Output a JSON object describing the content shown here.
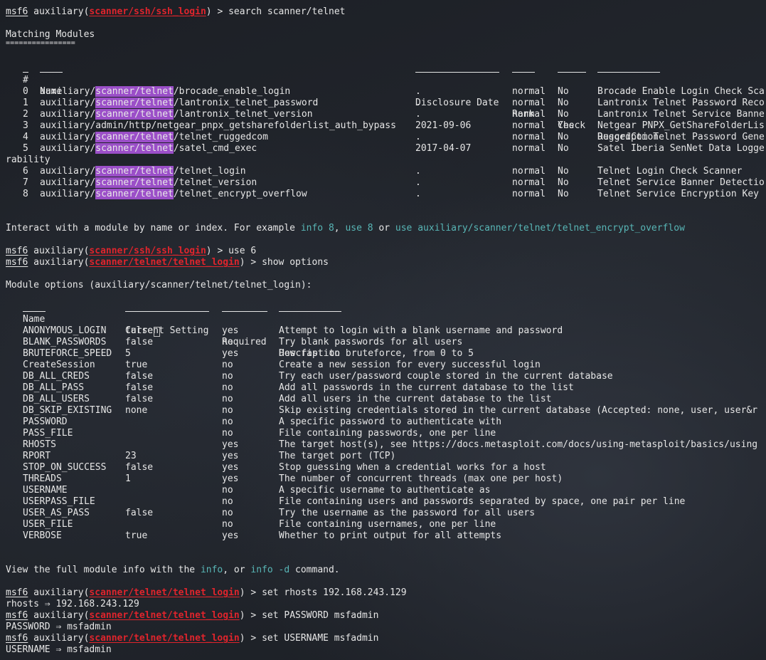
{
  "prompt": {
    "msf": "msf6",
    "aux": "auxiliary(",
    "close": ") > "
  },
  "line1": {
    "module": "scanner/ssh/ssh_login",
    "cmd": "search scanner/telnet"
  },
  "matching": {
    "title": "Matching Modules",
    "underline": "================"
  },
  "search_table": {
    "headers": {
      "num": "#",
      "name": "Name",
      "date": "Disclosure Date",
      "rank": "Rank",
      "check": "Check",
      "desc": "Description"
    },
    "rows": [
      {
        "num": "0",
        "pre": "auxiliary/",
        "hl": "scanner/telnet",
        "post": "/brocade_enable_login",
        "date": ".",
        "rank": "normal",
        "check": "No",
        "desc": "Brocade Enable Login Check Sca"
      },
      {
        "num": "1",
        "pre": "auxiliary/",
        "hl": "scanner/telnet",
        "post": "/lantronix_telnet_password",
        "date": ".",
        "rank": "normal",
        "check": "No",
        "desc": "Lantronix Telnet Password Reco"
      },
      {
        "num": "2",
        "pre": "auxiliary/",
        "hl": "scanner/telnet",
        "post": "/lantronix_telnet_version",
        "date": ".",
        "rank": "normal",
        "check": "No",
        "desc": "Lantronix Telnet Service Banne"
      },
      {
        "num": "3",
        "pre": "auxiliary/admin/http/netgear_pnpx_getsharefolderlist_auth_bypass",
        "hl": "",
        "post": "",
        "date": "2021-09-06",
        "rank": "normal",
        "check": "Yes",
        "desc": "Netgear PNPX_GetShareFolderLis"
      },
      {
        "num": "4",
        "pre": "auxiliary/",
        "hl": "scanner/telnet",
        "post": "/telnet_ruggedcom",
        "date": ".",
        "rank": "normal",
        "check": "No",
        "desc": "RuggedCom Telnet Password Gene"
      },
      {
        "num": "5",
        "pre": "auxiliary/",
        "hl": "scanner/telnet",
        "post": "/satel_cmd_exec",
        "date": "2017-04-07",
        "rank": "normal",
        "check": "No",
        "desc": "Satel Iberia SenNet Data Logge"
      },
      {
        "num": "6",
        "pre": "auxiliary/",
        "hl": "scanner/telnet",
        "post": "/telnet_login",
        "date": ".",
        "rank": "normal",
        "check": "No",
        "desc": "Telnet Login Check Scanner"
      },
      {
        "num": "7",
        "pre": "auxiliary/",
        "hl": "scanner/telnet",
        "post": "/telnet_version",
        "date": ".",
        "rank": "normal",
        "check": "No",
        "desc": "Telnet Service Banner Detectio"
      },
      {
        "num": "8",
        "pre": "auxiliary/",
        "hl": "scanner/telnet",
        "post": "/telnet_encrypt_overflow",
        "date": ".",
        "rank": "normal",
        "check": "No",
        "desc": "Telnet Service Encryption Key"
      }
    ],
    "wrap": "rability"
  },
  "interact": {
    "text": "Interact with a module by name or index. For example ",
    "info": "info 8",
    "comma": ", ",
    "use": "use 8",
    "or": " or ",
    "use_full": "use auxiliary/scanner/telnet/telnet_encrypt_overflow"
  },
  "cmd_use": {
    "module": "scanner/ssh/ssh_login",
    "cmd": "use 6"
  },
  "cmd_show": {
    "module": "scanner/telnet/telnet_login",
    "cmd": "show options"
  },
  "module_options": "Module options (auxiliary/scanner/telnet/telnet_login):",
  "options_table": {
    "headers": {
      "name": "Name",
      "setting": "Current Setting",
      "required": "Required",
      "desc": "Description"
    },
    "rows": [
      {
        "name": "ANONYMOUS_LOGIN",
        "setting": "false",
        "required": "yes",
        "desc": "Attempt to login with a blank username and password"
      },
      {
        "name": "BLANK_PASSWORDS",
        "setting": "false",
        "required": "no",
        "desc": "Try blank passwords for all users"
      },
      {
        "name": "BRUTEFORCE_SPEED",
        "setting": "5",
        "required": "yes",
        "desc": "How fast to bruteforce, from 0 to 5"
      },
      {
        "name": "CreateSession",
        "setting": "true",
        "required": "no",
        "desc": "Create a new session for every successful login"
      },
      {
        "name": "DB_ALL_CREDS",
        "setting": "false",
        "required": "no",
        "desc": "Try each user/password couple stored in the current database"
      },
      {
        "name": "DB_ALL_PASS",
        "setting": "false",
        "required": "no",
        "desc": "Add all passwords in the current database to the list"
      },
      {
        "name": "DB_ALL_USERS",
        "setting": "false",
        "required": "no",
        "desc": "Add all users in the current database to the list"
      },
      {
        "name": "DB_SKIP_EXISTING",
        "setting": "none",
        "required": "no",
        "desc": "Skip existing credentials stored in the current database (Accepted: none, user, user&r"
      },
      {
        "name": "PASSWORD",
        "setting": "",
        "required": "no",
        "desc": "A specific password to authenticate with"
      },
      {
        "name": "PASS_FILE",
        "setting": "",
        "required": "no",
        "desc": "File containing passwords, one per line"
      },
      {
        "name": "RHOSTS",
        "setting": "",
        "required": "yes",
        "desc": "The target host(s), see https://docs.metasploit.com/docs/using-metasploit/basics/using"
      },
      {
        "name": "RPORT",
        "setting": "23",
        "required": "yes",
        "desc": "The target port (TCP)"
      },
      {
        "name": "STOP_ON_SUCCESS",
        "setting": "false",
        "required": "yes",
        "desc": "Stop guessing when a credential works for a host"
      },
      {
        "name": "THREADS",
        "setting": "1",
        "required": "yes",
        "desc": "The number of concurrent threads (max one per host)"
      },
      {
        "name": "USERNAME",
        "setting": "",
        "required": "no",
        "desc": "A specific username to authenticate as"
      },
      {
        "name": "USERPASS_FILE",
        "setting": "",
        "required": "no",
        "desc": "File containing users and passwords separated by space, one pair per line"
      },
      {
        "name": "USER_AS_PASS",
        "setting": "false",
        "required": "no",
        "desc": "Try the username as the password for all users"
      },
      {
        "name": "USER_FILE",
        "setting": "",
        "required": "no",
        "desc": "File containing usernames, one per line"
      },
      {
        "name": "VERBOSE",
        "setting": "true",
        "required": "yes",
        "desc": "Whether to print output for all attempts"
      }
    ]
  },
  "view_info": {
    "text": "View the full module info with the ",
    "info": "info",
    "or": ", or ",
    "info_d": "info -d",
    "end": " command."
  },
  "cmd_rhosts": {
    "module": "scanner/telnet/telnet_login",
    "cmd": "set rhosts 192.168.243.129",
    "out": "rhosts ⇒ 192.168.243.129"
  },
  "cmd_password": {
    "module": "scanner/telnet/telnet_login",
    "cmd": "set PASSWORD msfadmin",
    "out": "PASSWORD ⇒ msfadmin"
  },
  "cmd_username": {
    "module": "scanner/telnet/telnet_login",
    "cmd": "set USERNAME msfadmin",
    "out": "USERNAME ⇒ msfadmin"
  }
}
